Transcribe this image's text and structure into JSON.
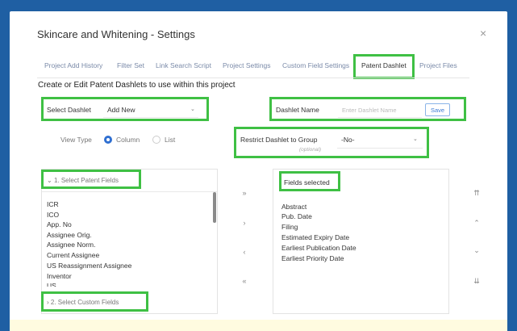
{
  "dialog": {
    "title": "Skincare and Whitening - Settings",
    "close_glyph": "×"
  },
  "tabs": [
    {
      "label": "Project Add History"
    },
    {
      "label": "Filter Set"
    },
    {
      "label": "Link Search Script"
    },
    {
      "label": "Project Settings"
    },
    {
      "label": "Custom Field Settings"
    },
    {
      "label": "Patent Dashlet",
      "active": true
    },
    {
      "label": "Project Files"
    }
  ],
  "heading": "Create or Edit Patent Dashlets to use within this project",
  "select_dashlet": {
    "label": "Select Dashlet",
    "value": "Add New"
  },
  "dashlet_name": {
    "label": "Dashlet Name",
    "placeholder": "Enter Dashlet Name",
    "save_label": "Save"
  },
  "view_type": {
    "label": "View Type",
    "options": [
      "Column",
      "List"
    ],
    "selected": "Column"
  },
  "restrict": {
    "label": "Restrict Dashlet to Group",
    "sublabel": "(optional)",
    "value": "-No-"
  },
  "patent_fields": {
    "header": "1. Select Patent Fields",
    "items": [
      "ICR",
      "ICO",
      "App. No",
      "Assignee Orig.",
      "Assignee Norm.",
      "Current Assignee",
      "US Reassignment Assignee",
      "Inventor",
      "US"
    ]
  },
  "custom_fields": {
    "header": "2. Select Custom Fields"
  },
  "fields_selected": {
    "header": "Fields selected",
    "items": [
      "Abstract",
      "Pub. Date",
      "Filing",
      "Estimated Expiry Date",
      "Earliest Publication Date",
      "Earliest Priority Date"
    ]
  },
  "transfer_controls": {
    "move_all_right": "»",
    "move_right": "›",
    "move_left": "‹",
    "move_all_left": "«"
  },
  "order_controls": {
    "top": "⇈",
    "up": "⌃",
    "down": "⌄",
    "bottom": "⇊"
  },
  "colors": {
    "frame": "#1f5fa3",
    "highlight": "#3fc044",
    "accent": "#2f6fd1"
  }
}
